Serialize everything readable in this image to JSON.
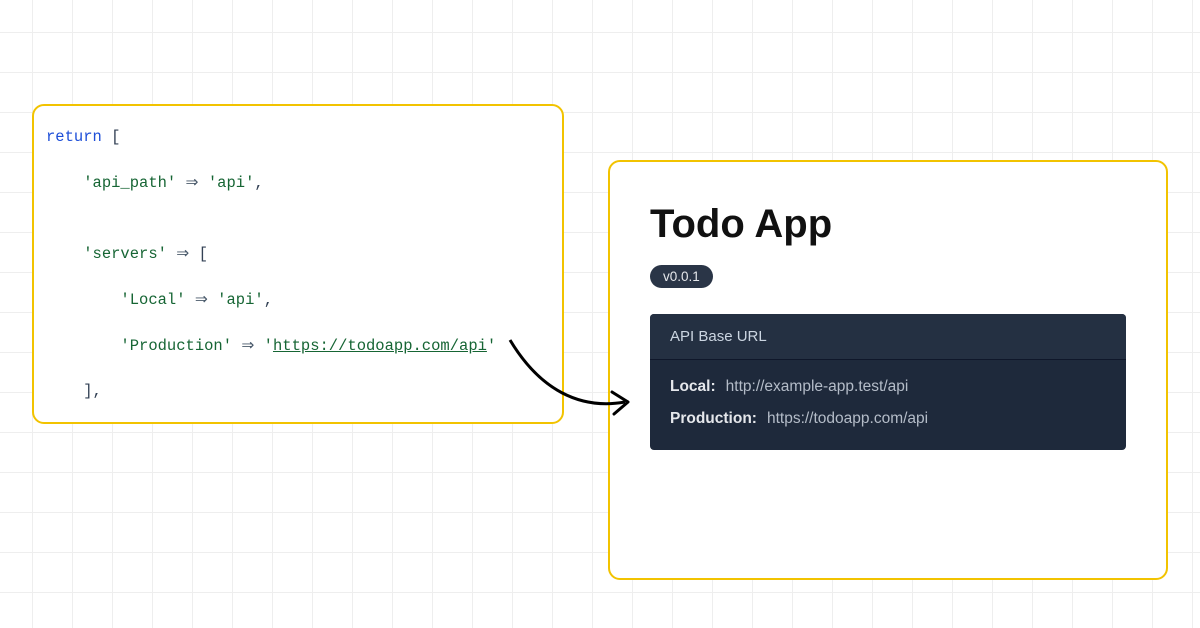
{
  "code": {
    "tokens": {
      "return": "return",
      "bracket_open": "[",
      "api_path_key": "'api_path'",
      "arrow": "⇒",
      "api_path_val": "'api'",
      "comma": ",",
      "servers_key": "'servers'",
      "local_key": "'Local'",
      "local_val": "'api'",
      "prod_key": "'Production'",
      "prod_quote": "'",
      "prod_url": "https://todoapp.com/api",
      "bracket_close": "]"
    }
  },
  "app": {
    "title": "Todo App",
    "version": "v0.0.1",
    "api_box": {
      "header": "API Base URL",
      "rows": [
        {
          "label": "Local:",
          "url": "http://example-app.test/api"
        },
        {
          "label": "Production:",
          "url": "https://todoapp.com/api"
        }
      ]
    }
  }
}
